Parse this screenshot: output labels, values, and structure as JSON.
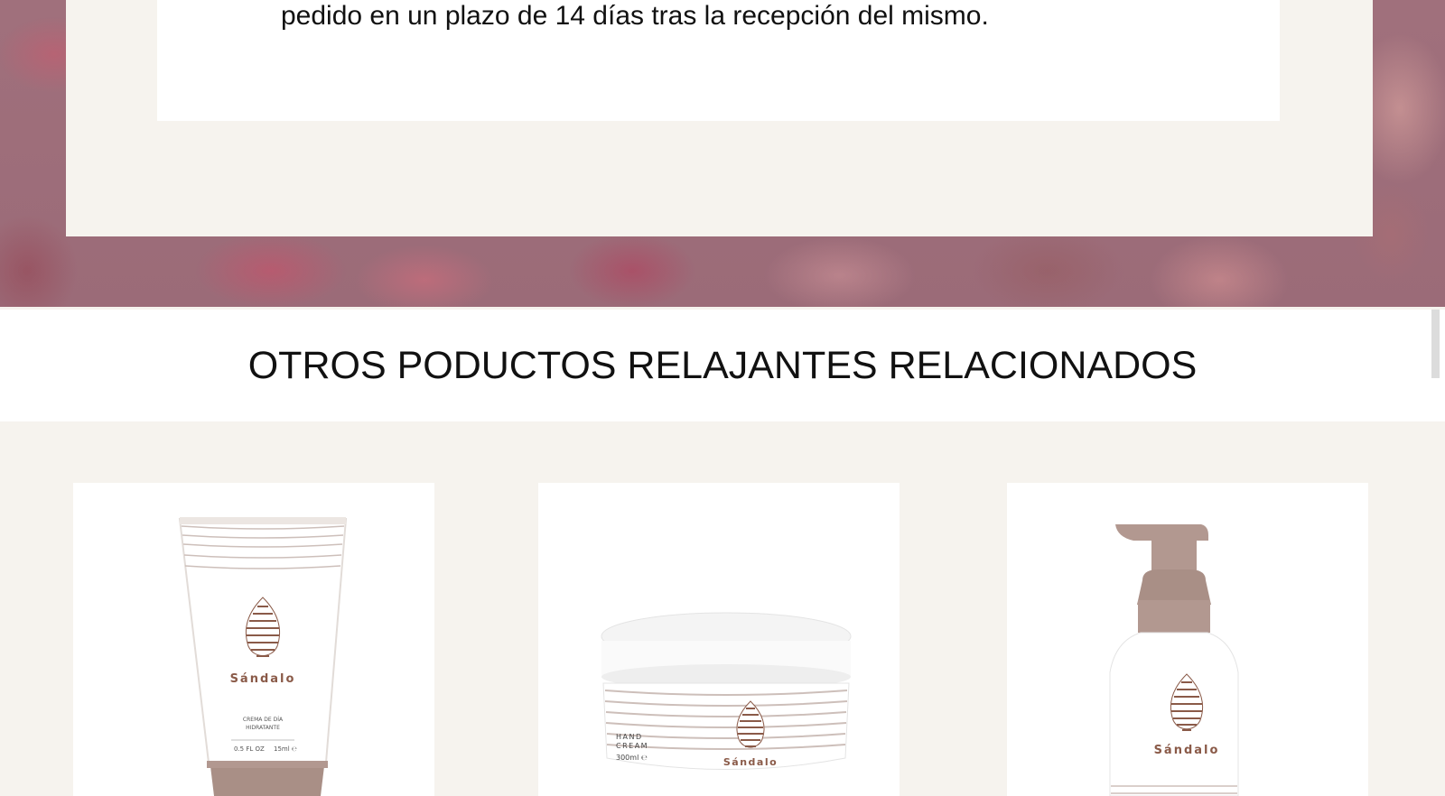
{
  "return_policy": {
    "text": "pedido en un plazo de 14 días tras la recepción del mismo."
  },
  "related_section": {
    "title": "OTROS PODUCTOS RELAJANTES RELACIONADOS"
  },
  "products": [
    {
      "image_alt": "tube-product-image",
      "brand": "Sándalo",
      "label_line1": "CREMA DE DÍA",
      "label_line2": "HIDRATANTE",
      "size": "0.5 FL OZ",
      "size_ml": "15ml ℮"
    },
    {
      "image_alt": "jar-product-image",
      "brand": "Sándalo",
      "label_line1": "HAND",
      "label_line2": "CREAM",
      "size_ml": "300ml ℮"
    },
    {
      "image_alt": "pump-bottle-product-image",
      "brand": "Sándalo"
    }
  ],
  "colors": {
    "cream_bg": "#f6f3ee",
    "brand_brown": "#8a5a48",
    "cap_taupe": "#b29890",
    "floral_overlay": "#9b6b78"
  }
}
